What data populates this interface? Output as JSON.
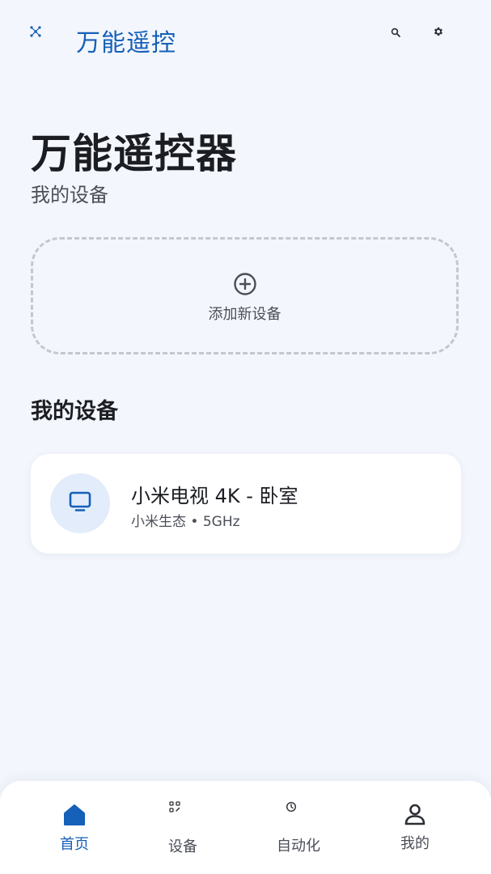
{
  "app": {
    "title": "万能遥控",
    "logo_icon": "hub-icon"
  },
  "toolbar": {
    "search_icon": "search-icon",
    "settings_icon": "gear-icon"
  },
  "hero": {
    "title": "万能遥控器",
    "subtitle": "我的设备"
  },
  "add_device": {
    "label": "添加新设备",
    "icon": "add-circle-icon"
  },
  "devices_section": {
    "title": "我的设备",
    "items": [
      {
        "name": "小米电视 4K - 卧室",
        "meta": "小米生态 • 5GHz",
        "icon": "tv-icon"
      }
    ]
  },
  "bottom_nav": {
    "items": [
      {
        "label": "首页",
        "icon": "home-icon",
        "active": true
      },
      {
        "label": "设备",
        "icon": "devices-icon",
        "active": false
      },
      {
        "label": "自动化",
        "icon": "clock-icon",
        "active": false
      },
      {
        "label": "我的",
        "icon": "person-icon",
        "active": false
      }
    ]
  },
  "colors": {
    "accent": "#1560b8",
    "background": "#f3f6fc",
    "card": "#ffffff",
    "avatar_bg": "#e3ecfb",
    "text_primary": "#1b1d22",
    "text_secondary": "#4a4e57",
    "dashed_border": "#c3c7cf"
  }
}
